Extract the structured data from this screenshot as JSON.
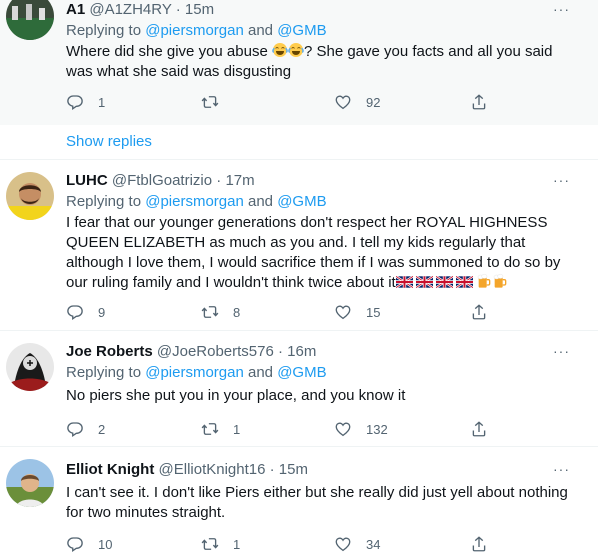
{
  "replying_label": "Replying to",
  "show_replies": "Show replies",
  "tweets": [
    {
      "name": "A1",
      "handle": "@A1ZH4RY",
      "time": "· 15m",
      "mentions": [
        "@piersmorgan",
        "and",
        "@GMB"
      ],
      "text_a": "Where did she give you abuse ",
      "text_b": "? She gave you facts and all you said was what she said was disgusting",
      "emojis": [
        "tears-of-joy",
        "tears-of-joy"
      ],
      "replies": "1",
      "retweets": "",
      "likes": "92"
    },
    {
      "name": "LUHC",
      "handle": "@FtblGoatrizio",
      "time": "· 17m",
      "mentions": [
        "@piersmorgan",
        "and",
        "@GMB"
      ],
      "text": "I fear that our younger generations don't respect her ROYAL HIGHNESS QUEEN ELIZABETH as much as you and. I tell my kids regularly that although I love them, I would sacrifice them if I was summoned to do so by our ruling family and I wouldn't think twice about it",
      "emojis": [
        "uk-flag",
        "uk-flag",
        "uk-flag",
        "uk-flag",
        "beer-mug",
        "beer-mug"
      ],
      "replies": "9",
      "retweets": "8",
      "likes": "15"
    },
    {
      "name": "Joe Roberts",
      "handle": "@JoeRoberts576",
      "time": "· 16m",
      "mentions": [
        "@piersmorgan",
        "and",
        "@GMB"
      ],
      "text": "No piers she put you in your place, and you know it",
      "replies": "2",
      "retweets": "1",
      "likes": "132"
    },
    {
      "name": "Elliot Knight",
      "handle": "@ElliotKnight16",
      "time": "· 15m",
      "text": "I can't see it. I don't like Piers either but she really did just yell about nothing for two minutes straight.",
      "replies": "10",
      "retweets": "1",
      "likes": "34"
    }
  ],
  "more_glyph": "···",
  "colors": {
    "link": "#1d9bf0",
    "muted": "#536471",
    "text": "#0f1419",
    "divider": "#eff3f4"
  }
}
